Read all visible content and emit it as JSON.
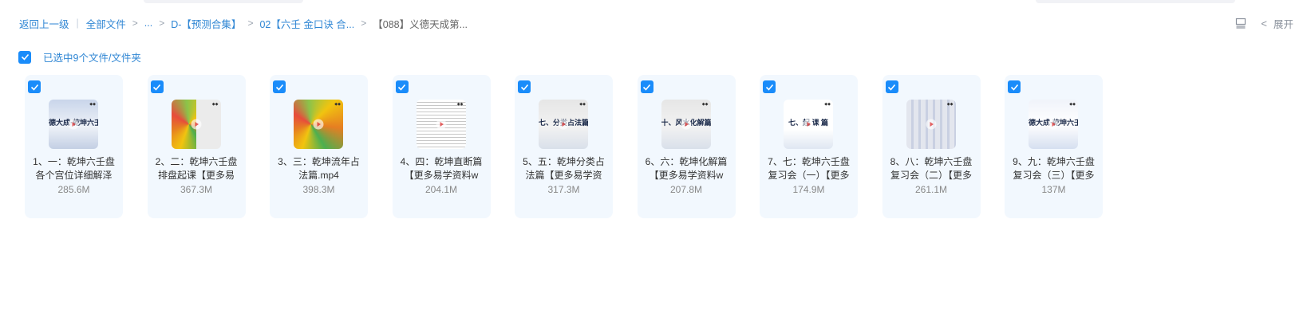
{
  "breadcrumb": {
    "back": "返回上一级",
    "all_files": "全部文件",
    "ellipsis": "...",
    "crumb1": "D-【预测合集】",
    "crumb2": "02【六壬 金口诀 合...",
    "current": "【088】义德天成第..."
  },
  "toolbar": {
    "expand_label": "展开"
  },
  "selection": {
    "label": "已选中9个文件/文件夹"
  },
  "colors": {
    "accent": "#1a8cfa",
    "link": "#2f86d4",
    "card_bg": "#f2f8fe"
  },
  "files": [
    {
      "name": "1、一：乾坤六壬盘各个宫位详细解泽",
      "size": "285.6M",
      "thumb_text": "德大成·乾坤六壬",
      "thumb_style": "blue",
      "icon": "video-thumbnail"
    },
    {
      "name": "2、二：乾坤六壬盘排盘起课【更多易",
      "size": "367.3M",
      "thumb_text": "",
      "thumb_style": "colorful-wheel-small",
      "icon": "video-thumbnail"
    },
    {
      "name": "3、三：乾坤流年占法篇.mp4",
      "size": "398.3M",
      "thumb_text": "",
      "thumb_style": "colorful-wheel",
      "icon": "video-thumbnail"
    },
    {
      "name": "4、四：乾坤直断篇【更多易学资料w",
      "size": "204.1M",
      "thumb_text": "",
      "thumb_style": "document",
      "icon": "video-thumbnail"
    },
    {
      "name": "5、五：乾坤分类占法篇【更多易学资",
      "size": "317.3M",
      "thumb_text": "七、分类占法篇",
      "thumb_style": "grey",
      "icon": "video-thumbnail"
    },
    {
      "name": "6、六：乾坤化解篇【更多易学资料w",
      "size": "207.8M",
      "thumb_text": "十、风水化解篇",
      "thumb_style": "grey",
      "icon": "video-thumbnail"
    },
    {
      "name": "7、七：乾坤六壬盘复习会（一）【更多易",
      "size": "174.9M",
      "thumb_text": "七、起 课 篇",
      "thumb_style": "white",
      "icon": "video-thumbnail"
    },
    {
      "name": "8、八：乾坤六壬盘复习会（二）【更多易",
      "size": "261.1M",
      "thumb_text": "",
      "thumb_style": "screen",
      "icon": "video-thumbnail"
    },
    {
      "name": "9、九：乾坤六壬盘复习会（三）【更多易",
      "size": "137M",
      "thumb_text": "德大成·乾坤六壬",
      "thumb_style": "light-blue",
      "icon": "video-thumbnail"
    }
  ]
}
